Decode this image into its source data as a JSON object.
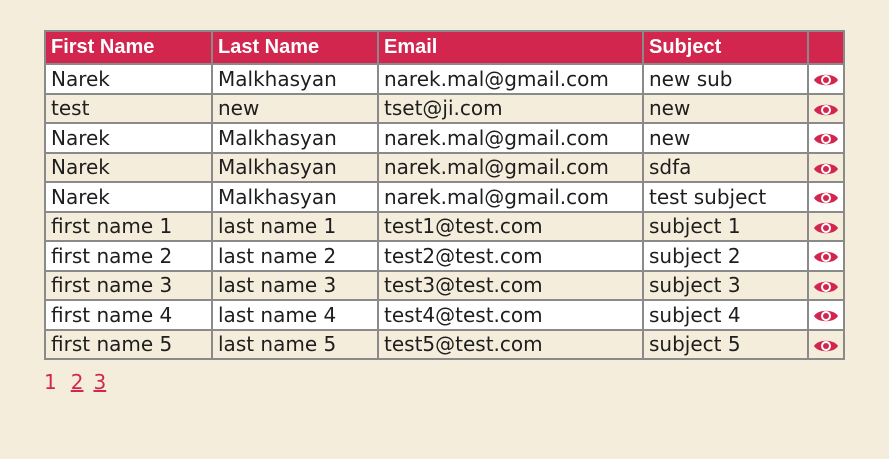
{
  "colors": {
    "accent": "#d2264f",
    "background": "#f5eddc",
    "border": "#8a8a8a"
  },
  "table": {
    "headers": [
      "First Name",
      "Last Name",
      "Email",
      "Subject",
      ""
    ],
    "rows": [
      [
        "Narek",
        "Malkhasyan",
        "narek.mal@gmail.com",
        "new sub"
      ],
      [
        "test",
        "new",
        "tset@ji.com",
        "new"
      ],
      [
        "Narek",
        "Malkhasyan",
        "narek.mal@gmail.com",
        "new"
      ],
      [
        "Narek",
        "Malkhasyan",
        "narek.mal@gmail.com",
        "sdfa"
      ],
      [
        "Narek",
        "Malkhasyan",
        "narek.mal@gmail.com",
        "test subject"
      ],
      [
        "first name 1",
        "last name 1",
        "test1@test.com",
        "subject 1"
      ],
      [
        "first name 2",
        "last name 2",
        "test2@test.com",
        "subject 2"
      ],
      [
        "first name 3",
        "last name 3",
        "test3@test.com",
        "subject 3"
      ],
      [
        "first name 4",
        "last name 4",
        "test4@test.com",
        "subject 4"
      ],
      [
        "first name 5",
        "last name 5",
        "test5@test.com",
        "subject 5"
      ]
    ],
    "action_icon": "eye-icon"
  },
  "pagination": {
    "current": "1",
    "pages": [
      "2",
      "3"
    ]
  }
}
